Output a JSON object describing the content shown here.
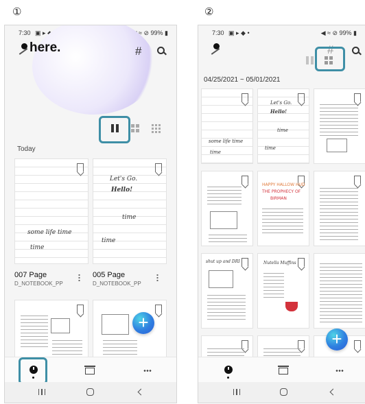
{
  "steps": [
    "①",
    "②"
  ],
  "status": {
    "time": "7:30",
    "icons": "▣ ▸ ◆ •",
    "right": "◀ ≈ ⊘ 99% ▮"
  },
  "screen1": {
    "header_title": "here.",
    "section_today": "Today",
    "cards": [
      {
        "title": "007 Page",
        "subtitle": "D_NOTEBOOK_PP",
        "ink": [
          "some life time",
          "time"
        ]
      },
      {
        "title": "005 Page",
        "subtitle": "D_NOTEBOOK_PP",
        "ink": [
          "Let's Go.",
          "Hello!",
          "time",
          "time"
        ]
      }
    ]
  },
  "screen2": {
    "date_range": "04/25/2021 ~ 05/01/2021",
    "ink": {
      "a": [
        "some life time",
        "time"
      ],
      "b": [
        "Let's Go.",
        "Hello!",
        "time",
        "time"
      ],
      "d1": "HAPPY HALLOW HUD",
      "d2": "THE PROPHECY OF",
      "d3": "BIRMAN",
      "e": "shut up and DRI",
      "f": "Nutella Muffins"
    }
  },
  "colors": {
    "highlight": "#3e8fa6",
    "fab": "#2f7fe0",
    "accent_orange": "#e07a3a",
    "accent_red": "#d3323b"
  },
  "icons": {
    "pen": "pen-icon",
    "tag": "hashtag-icon",
    "search": "search-icon",
    "view_list": "two-column-view-icon",
    "view_grid4": "grid-view-icon",
    "view_grid9": "dense-grid-view-icon",
    "fab": "plus-icon",
    "nav_recent": "clock-icon",
    "nav_collection": "tray-icon",
    "nav_more": "more-icon"
  },
  "fab_label": "+"
}
